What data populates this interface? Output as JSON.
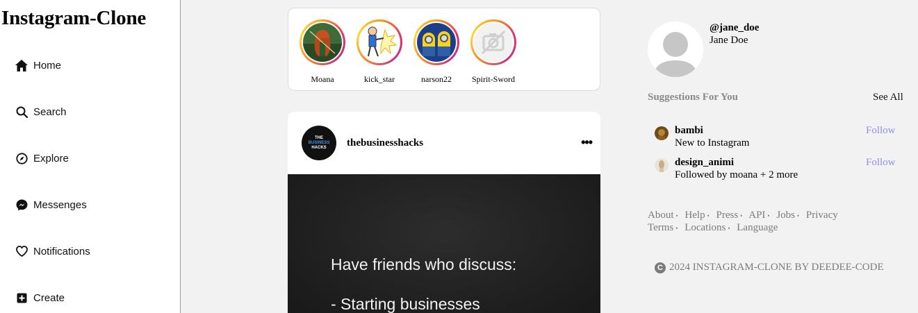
{
  "sidebar": {
    "brand": "Instagram-Clone",
    "items": [
      {
        "label": "Home",
        "icon": "home-icon"
      },
      {
        "label": "Search",
        "icon": "search-icon"
      },
      {
        "label": "Explore",
        "icon": "compass-icon"
      },
      {
        "label": "Messenges",
        "icon": "messenger-icon"
      },
      {
        "label": "Notifications",
        "icon": "heart-icon"
      },
      {
        "label": "Create",
        "icon": "plus-square-icon"
      }
    ]
  },
  "stories": [
    {
      "name": "Moana"
    },
    {
      "name": "kick_star"
    },
    {
      "name": "narson22"
    },
    {
      "name": "Spirit-Sword"
    }
  ],
  "post": {
    "username": "thebusinesshacks",
    "avatar_text_top": "THE",
    "avatar_text_mid": "BUSINESS",
    "avatar_text_bot": "HACKS",
    "more": "•••",
    "image_line1": "Have friends who discuss:",
    "image_line2": "- Starting businesses"
  },
  "profile": {
    "handle": "@jane_doe",
    "name": "Jane Doe"
  },
  "suggestions": {
    "title": "Suggestions For You",
    "see_all": "See All",
    "items": [
      {
        "username": "bambi",
        "subtitle": "New to Instagram",
        "follow": "Follow"
      },
      {
        "username": "design_animi",
        "subtitle": "Followed by moana + 2 more",
        "follow": "Follow"
      }
    ]
  },
  "footer": {
    "row1": [
      "About",
      "Help",
      "Press",
      "API",
      "Jobs",
      "Privacy"
    ],
    "row2": [
      "Terms",
      "Locations",
      "Language"
    ],
    "dot": "•",
    "copyright_symbol": "C",
    "copyright": "2024 INSTAGRAM-CLONE BY DEEDEE-CODE"
  },
  "colors": {
    "follow": "#8f8ff0",
    "muted": "#7b7b7b",
    "background": "#f3f2f3"
  }
}
